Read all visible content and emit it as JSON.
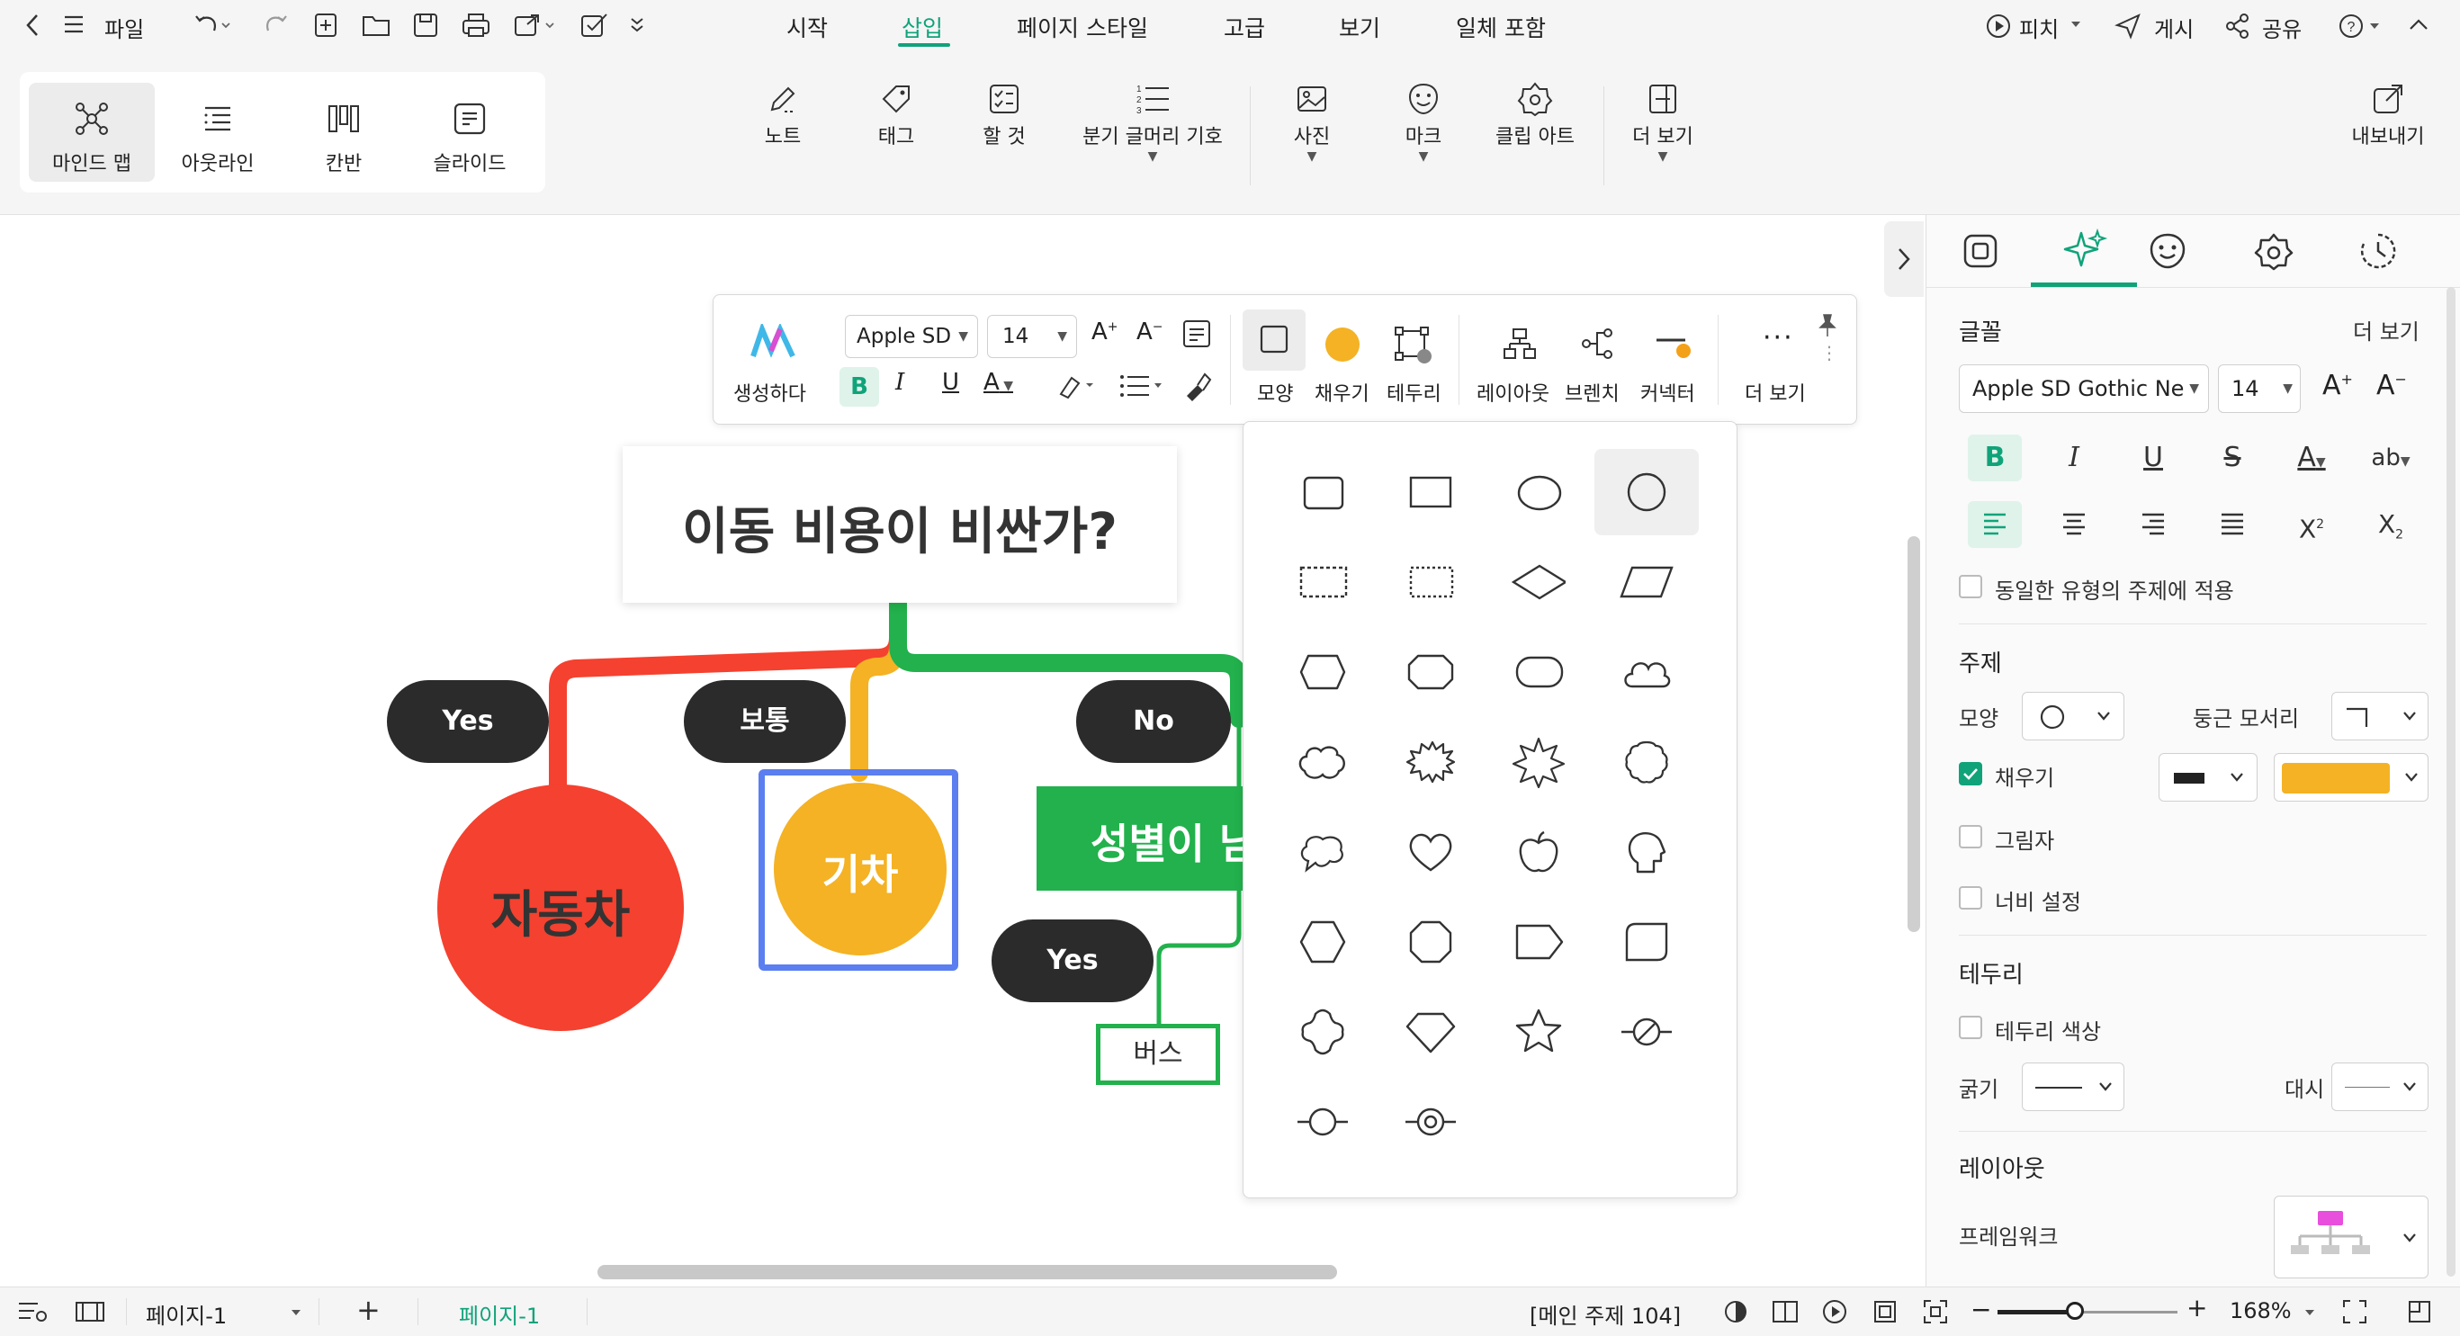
{
  "menubar": {
    "file_label": "파일",
    "tabs": [
      "시작",
      "삽입",
      "페이지 스타일",
      "고급",
      "보기",
      "일체 포함"
    ],
    "active_tab": "삽입",
    "pitch_label": "피치",
    "publish_label": "게시",
    "share_label": "공유"
  },
  "ribbon": {
    "views": [
      "마인드 맵",
      "아웃라인",
      "칸반",
      "슬라이드"
    ],
    "insert_buttons": [
      "노트",
      "태그",
      "할 것",
      "분기 글머리 기호",
      "사진",
      "마크",
      "클립 아트",
      "더 보기"
    ],
    "export_label": "내보내기"
  },
  "float_toolbar": {
    "generate_label": "생성하다",
    "font_name": "Apple SD",
    "font_size": "14",
    "shape_label": "모양",
    "fill_label": "채우기",
    "border_label": "테두리",
    "layout_label": "레이아웃",
    "branch_label": "브렌치",
    "connector_label": "커넥터",
    "more_label": "더 보기"
  },
  "mindmap": {
    "root": "이동 비용이 비싼가?",
    "branches": [
      {
        "label": "Yes",
        "child": "자동차",
        "color": "#f5412f"
      },
      {
        "label": "보통",
        "child": "기차",
        "color": "#f4b224"
      },
      {
        "label": "No",
        "child": "성별이 남",
        "color": "#22b14c"
      }
    ],
    "sub_label": "Yes",
    "sub_child": "버스"
  },
  "right_panel": {
    "font_section": "글꼴",
    "more": "더 보기",
    "font_name": "Apple SD Gothic Ne",
    "font_size": "14",
    "apply_same": "동일한 유형의 주제에 적용",
    "topic_section": "주제",
    "shape": "모양",
    "rounded_corner": "둥근 모서리",
    "fill": "채우기",
    "fill_color": "#f4b224",
    "shadow": "그림자",
    "width_setting": "너비 설정",
    "border_section": "테두리",
    "border_color": "테두리 색상",
    "thickness": "굵기",
    "dash": "대시",
    "layout_section": "레이아웃",
    "framework": "프레임워크"
  },
  "statusbar": {
    "page_select": "페이지-1",
    "page_tab": "페이지-1",
    "main_topic": "[메인 주제 104]",
    "zoom": "168%"
  },
  "colors": {
    "accent": "#10a37a",
    "selection": "#5b7ff0",
    "dark_pill": "#2b2b2b"
  }
}
